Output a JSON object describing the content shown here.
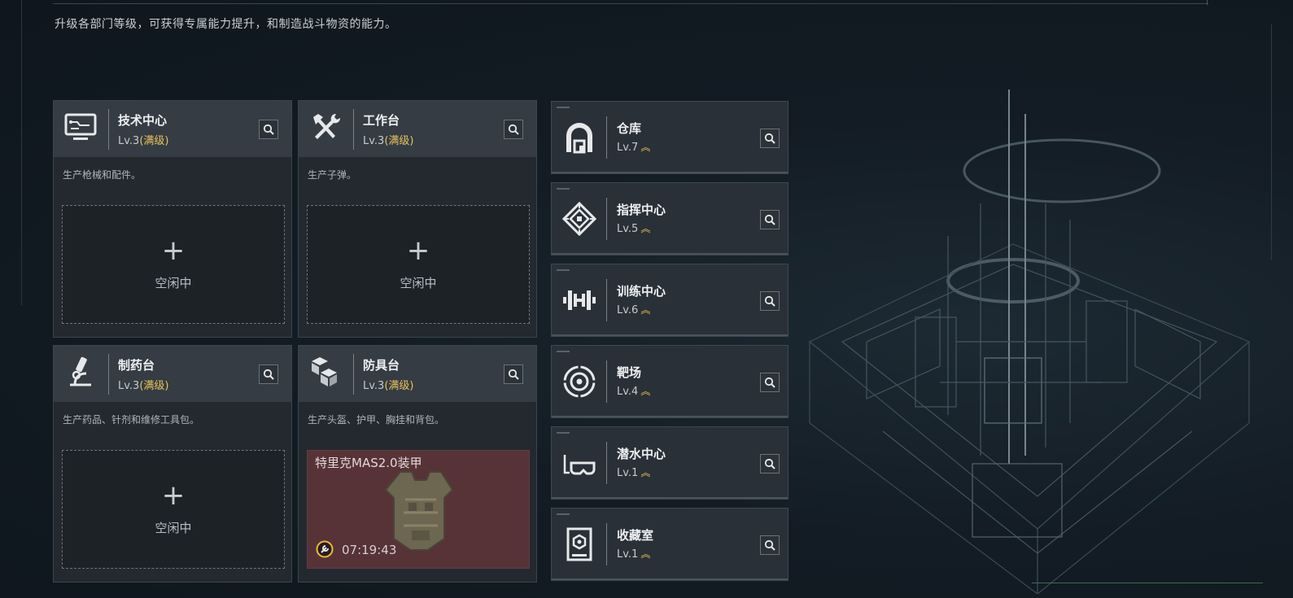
{
  "subtitle": "升级各部门等级，可获得专属能力提升，和制造战斗物资的能力。",
  "workshops": [
    {
      "name": "技术中心",
      "level": "Lv.3",
      "max_label": "(满级)",
      "desc": "生产枪械和配件。",
      "slot_status": "空闲中",
      "icon": "computer-icon"
    },
    {
      "name": "工作台",
      "level": "Lv.3",
      "max_label": "(满级)",
      "desc": "生产子弹。",
      "slot_status": "空闲中",
      "icon": "hammer-wrench-icon"
    },
    {
      "name": "制药台",
      "level": "Lv.3",
      "max_label": "(满级)",
      "desc": "生产药品、针剂和维修工具包。",
      "slot_status": "空闲中",
      "icon": "microscope-icon"
    },
    {
      "name": "防具台",
      "level": "Lv.3",
      "max_label": "(满级)",
      "desc": "生产头盔、护甲、胸挂和背包。",
      "crafting_item": "特里克MAS2.0装甲",
      "timer": "07:19:43",
      "icon": "cubes-icon"
    }
  ],
  "facilities": [
    {
      "name": "仓库",
      "level": "Lv.7",
      "icon": "warehouse-icon"
    },
    {
      "name": "指挥中心",
      "level": "Lv.5",
      "icon": "command-emblem-icon"
    },
    {
      "name": "训练中心",
      "level": "Lv.6",
      "icon": "dumbbell-icon"
    },
    {
      "name": "靶场",
      "level": "Lv.4",
      "icon": "target-icon"
    },
    {
      "name": "潜水中心",
      "level": "Lv.1",
      "icon": "diving-mask-icon"
    },
    {
      "name": "收藏室",
      "level": "Lv.1",
      "icon": "collection-case-icon"
    }
  ],
  "colors": {
    "max_level": "#e8c25c",
    "crafting_slot": "#573338"
  }
}
